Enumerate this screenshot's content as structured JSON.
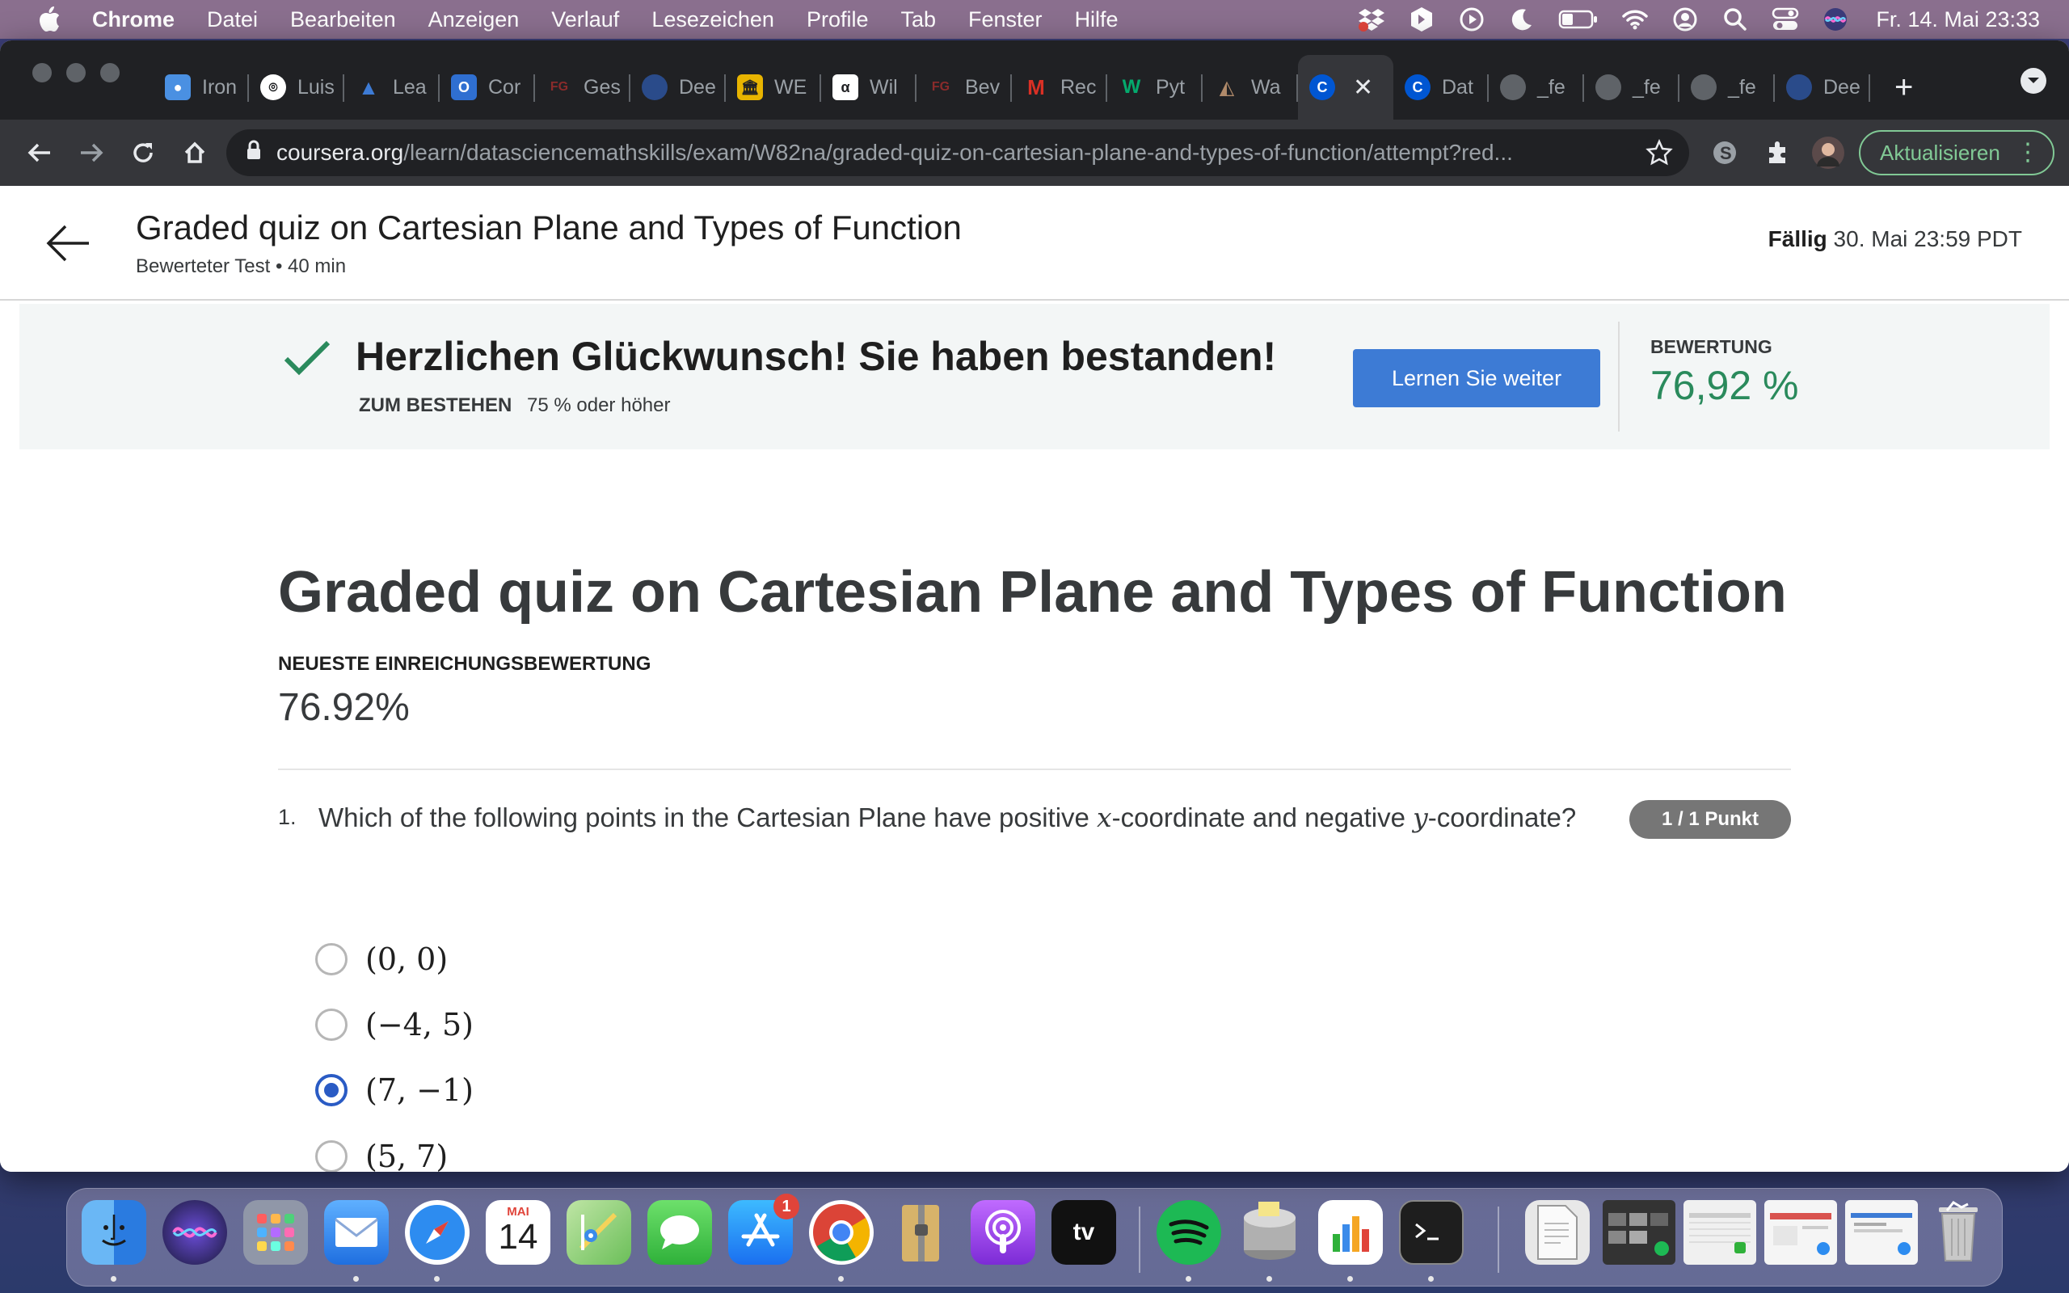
{
  "menubar": {
    "app_name": "Chrome",
    "items": [
      "Datei",
      "Bearbeiten",
      "Anzeigen",
      "Verlauf",
      "Lesezeichen",
      "Profile",
      "Tab",
      "Fenster",
      "Hilfe"
    ],
    "clock": "Fr. 14. Mai  23:33"
  },
  "tabs": [
    {
      "label": "Iron",
      "icon": "iron-icon",
      "color": "#4a90e2"
    },
    {
      "label": "Luis",
      "icon": "github-icon",
      "color": "#ffffff"
    },
    {
      "label": "Lea",
      "icon": "triangle-icon",
      "color": "#3d7bd5"
    },
    {
      "label": "Cor",
      "icon": "outlook-icon",
      "color": "#2f6fd1"
    },
    {
      "label": "Ges",
      "icon": "fg-icon",
      "color": "#8a2b2b"
    },
    {
      "label": "Dee",
      "icon": "globe-icon",
      "color": "#2a4b8a"
    },
    {
      "label": "WE",
      "icon": "bank-icon",
      "color": "#e8b400"
    },
    {
      "label": "Wil",
      "icon": "alpha-icon",
      "color": "#ffffff"
    },
    {
      "label": "Bev",
      "icon": "fg-icon",
      "color": "#8a2b2b"
    },
    {
      "label": "Rec",
      "icon": "gmail-icon",
      "color": "#d93025"
    },
    {
      "label": "Pyt",
      "icon": "w3-icon",
      "color": "#04aa6d"
    },
    {
      "label": "Wa",
      "icon": "pyramid-icon",
      "color": "#7a5b4a"
    },
    {
      "label": "",
      "icon": "coursera-icon",
      "color": "#0056d2",
      "active": true
    },
    {
      "label": "Dat",
      "icon": "coursera-icon",
      "color": "#0056d2"
    },
    {
      "label": "_fe",
      "icon": "globe-icon",
      "color": "#5f6368"
    },
    {
      "label": "_fe",
      "icon": "globe-icon",
      "color": "#5f6368"
    },
    {
      "label": "_fe",
      "icon": "globe-icon",
      "color": "#5f6368"
    },
    {
      "label": "Dee",
      "icon": "globe-icon",
      "color": "#2a4b8a"
    }
  ],
  "omnibox": {
    "host": "coursera.org",
    "path": "/learn/datasciencemathskills/exam/W82na/graded-quiz-on-cartesian-plane-and-types-of-function/attempt?red..."
  },
  "update_button": "Aktualisieren",
  "header": {
    "title": "Graded quiz on Cartesian Plane and Types of Function",
    "subtitle": "Bewerteter Test • 40 min",
    "due_label": "Fällig",
    "due_value": "30. Mai 23:59 PDT"
  },
  "banner": {
    "message": "Herzlichen Glückwunsch! Sie haben bestanden!",
    "pass_label": "ZUM BESTEHEN",
    "pass_value": "75 % oder höher",
    "continue_label": "Lernen Sie weiter",
    "grade_label": "BEWERTUNG",
    "grade_value": "76,92 %"
  },
  "quiz": {
    "title": "Graded quiz on Cartesian Plane and Types of Function",
    "latest_label": "NEUESTE EINREICHUNGSBEWERTUNG",
    "latest_score": "76.92%",
    "question": {
      "number": "1.",
      "text_part1": "Which of the following points in the Cartesian Plane have positive ",
      "var_x": "x",
      "text_part2": "-coordinate and negative ",
      "var_y": "y",
      "text_part3": "-coordinate?",
      "points": "1 / 1 Punkt",
      "options": [
        {
          "label": "(0, 0)",
          "selected": false
        },
        {
          "label": "(−4, 5)",
          "selected": false
        },
        {
          "label": "(7, −1)",
          "selected": true
        },
        {
          "label": "(5, 7)",
          "selected": false
        }
      ]
    }
  },
  "dock": {
    "apps": [
      {
        "name": "finder-icon",
        "color": "#3a8ee6"
      },
      {
        "name": "siri-icon",
        "color": "#2c2c54"
      },
      {
        "name": "launchpad-icon",
        "color": "#8a8fa0"
      },
      {
        "name": "mail-icon",
        "color": "#3b8bea"
      },
      {
        "name": "safari-icon",
        "color": "#2d8cf0"
      },
      {
        "name": "calendar-icon",
        "color": "#ffffff",
        "month": "MAI",
        "day": "14"
      },
      {
        "name": "maps-icon",
        "color": "#6bbf59"
      },
      {
        "name": "messages-icon",
        "color": "#3ccb4b"
      },
      {
        "name": "app-store-icon",
        "color": "#2a8df2",
        "badge": "1"
      },
      {
        "name": "chrome-icon",
        "color": "#ffffff"
      },
      {
        "name": "archive-utility-icon",
        "color": "#c9a85a"
      },
      {
        "name": "podcasts-icon",
        "color": "#9b4fd6"
      },
      {
        "name": "apple-tv-icon",
        "color": "#111111",
        "label": "tv"
      },
      {
        "name": "spotify-icon",
        "color": "#1db954"
      },
      {
        "name": "disk-utility-icon",
        "color": "#b0b0b0"
      },
      {
        "name": "numbers-icon",
        "color": "#ffffff"
      },
      {
        "name": "terminal-icon",
        "color": "#1e1e1e"
      },
      {
        "name": "document-icon",
        "color": "#e8e8e8"
      },
      {
        "name": "window-thumbnail-icon",
        "color": "#333333"
      },
      {
        "name": "window-thumbnail-icon",
        "color": "#f0f0f0"
      },
      {
        "name": "window-thumbnail-icon",
        "color": "#f5f5f5"
      },
      {
        "name": "window-thumbnail-icon",
        "color": "#f5f5f5"
      },
      {
        "name": "trash-icon",
        "color": "#cfcfcf"
      }
    ]
  }
}
